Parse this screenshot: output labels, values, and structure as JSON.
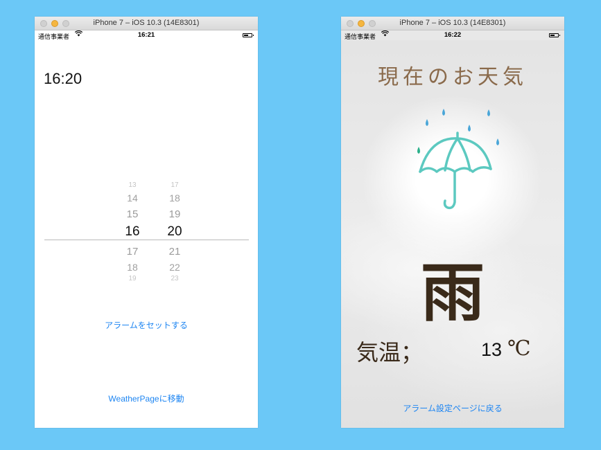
{
  "simulator_left": {
    "window_title": "iPhone 7 – iOS 10.3 (14E8301)",
    "status": {
      "carrier": "通信事業者",
      "wifi_icon": "wifi-icon",
      "time": "16:21",
      "battery_icon": "battery-icon"
    },
    "alarm_time": "16:20",
    "picker": {
      "hours": [
        "13",
        "14",
        "15",
        "16",
        "17",
        "18",
        "19"
      ],
      "minutes": [
        "17",
        "18",
        "19",
        "20",
        "21",
        "22",
        "23"
      ],
      "selected_hour": "16",
      "selected_minute": "20"
    },
    "set_alarm_button": "アラームをセットする",
    "weather_page_button": "WeatherPageに移動"
  },
  "simulator_right": {
    "window_title": "iPhone 7 – iOS 10.3 (14E8301)",
    "status": {
      "carrier": "通信事業者",
      "wifi_icon": "wifi-icon",
      "time": "16:22",
      "battery_icon": "battery-icon"
    },
    "heading": "現在のお天気",
    "weather_icon": "umbrella-rain-icon",
    "weather": "雨",
    "temp_label": "気温；",
    "temp_value": "13",
    "temp_unit": "℃",
    "back_button": "アラーム設定ページに戻る"
  },
  "colors": {
    "background": "#6bc8f7",
    "link": "#1d85f2",
    "heading_brown": "#8a6a4b",
    "text_dark_brown": "#3a2a1a",
    "umbrella": "#5cc9c0",
    "rain": "#4aa6d8"
  }
}
